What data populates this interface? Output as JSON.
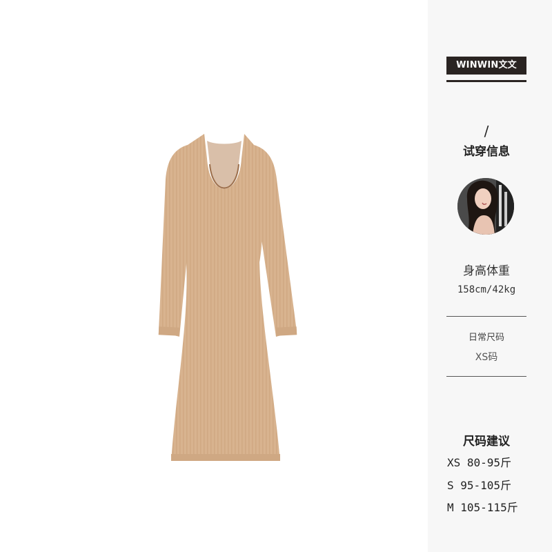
{
  "brand": {
    "name": "WINWIN文文"
  },
  "fitting": {
    "slash": "/",
    "title": "试穿信息"
  },
  "model": {
    "avatar_icon": "model-portrait",
    "measure_label": "身高体重",
    "measure_value": "158cm/42kg",
    "daily_size_label": "日常尺码",
    "daily_size_value": "XS码"
  },
  "size_guide": {
    "title": "尺码建议",
    "rows": [
      "XS 80-95斤",
      "S 95-105斤",
      "M 105-115斤"
    ]
  },
  "colors": {
    "knit": "#d9b48f",
    "badge": "#2a2422"
  }
}
